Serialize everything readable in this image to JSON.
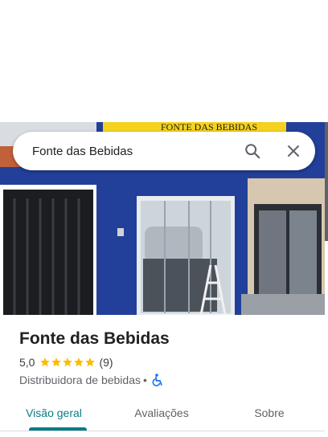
{
  "search": {
    "value": "Fonte das Bebidas",
    "search_icon": "search-icon",
    "close_icon": "close-icon"
  },
  "photo": {
    "sign_text": "FONTE DAS BEBIDAS",
    "description_icon": "storefront-photo"
  },
  "place": {
    "name": "Fonte das Bebidas",
    "rating": "5,0",
    "rating_value": 5,
    "stars_max": 5,
    "review_count": "(9)",
    "category": "Distribuidora de bebidas",
    "separator": "•",
    "accessibility_icon": "wheelchair-icon"
  },
  "tabs": [
    {
      "label": "Visão geral",
      "active": true
    },
    {
      "label": "Avaliações",
      "active": false
    },
    {
      "label": "Sobre",
      "active": false
    }
  ],
  "colors": {
    "accent": "#0b7c84",
    "star": "#fbbc04",
    "accessibility": "#1a73e8",
    "facade_blue": "#22409a",
    "sign_yellow": "#f4d21f"
  }
}
